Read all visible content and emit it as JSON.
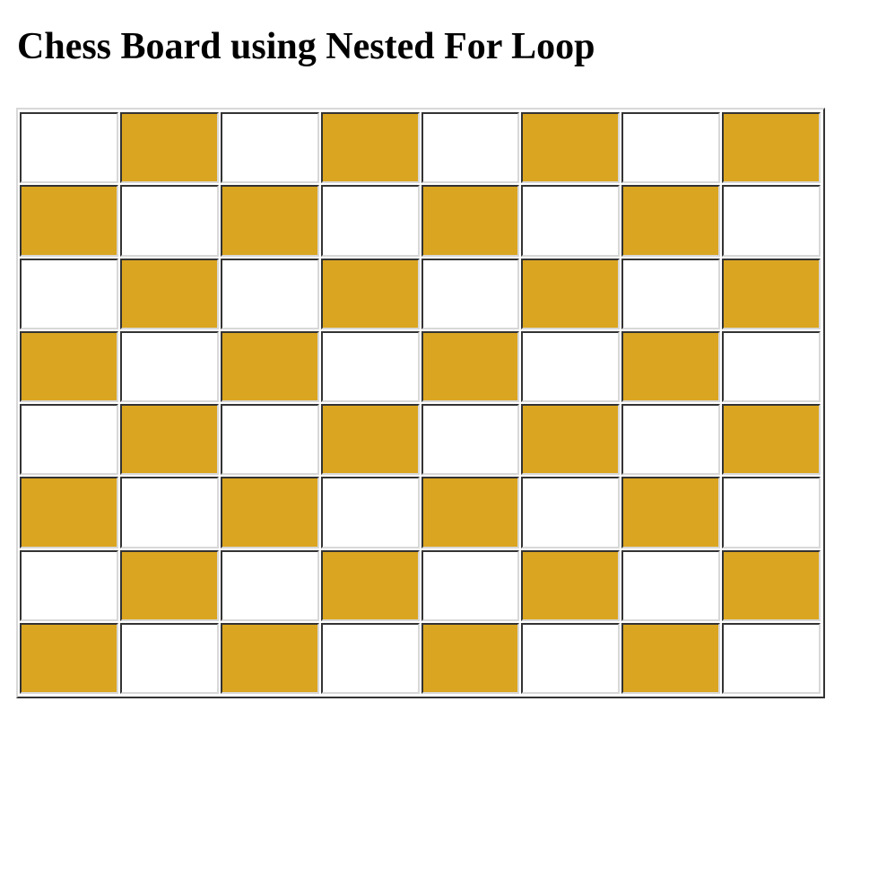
{
  "page": {
    "title": "Chess Board using Nested For Loop"
  },
  "board": {
    "rows": 8,
    "columns": 8,
    "first_square_color": "light",
    "colors": {
      "light": "#ffffff",
      "dark": "#daa520"
    }
  }
}
